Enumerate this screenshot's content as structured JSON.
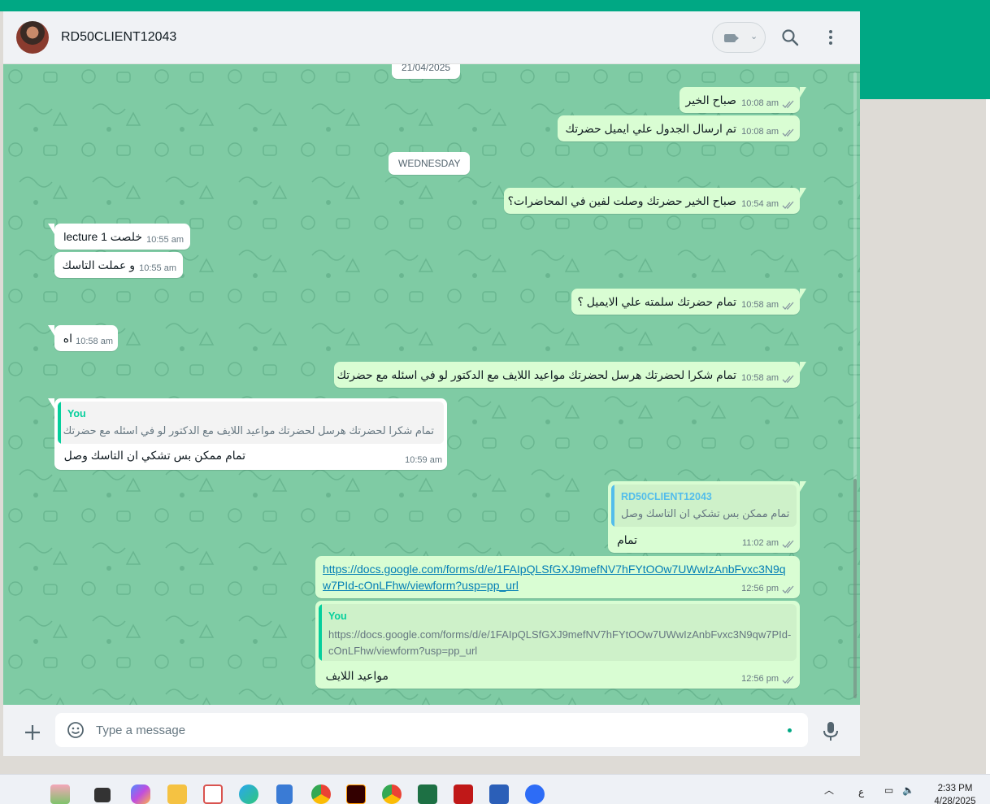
{
  "contact": {
    "name": "RD50CLIENT12043"
  },
  "date_chips": {
    "top": "21/04/2025",
    "wednesday": "WEDNESDAY"
  },
  "messages": [
    {
      "text": "صباح الخير",
      "time": "10:08 am"
    },
    {
      "text": "تم ارسال الجدول علي  ايميل  حضرتك",
      "time": "10:08 am"
    },
    {
      "text": "صباح الخير حضرتك وصلت لفين في المحاضرات؟",
      "time": "10:54 am"
    },
    {
      "text": "خلصت lecture 1",
      "time": "10:55 am"
    },
    {
      "text": "و عملت التاسك",
      "time": "10:55 am"
    },
    {
      "text": "تمام حضرتك سلمته علي الايميل ؟",
      "time": "10:58 am"
    },
    {
      "text": "اه",
      "time": "10:58 am"
    },
    {
      "text": "تمام شكرا لحضرتك هرسل لحضرتك مواعيد اللايف مع الدكتور لو في اسئله مع حضرتك",
      "time": "10:58 am"
    },
    {
      "quote_author": "You",
      "quote_text": "تمام شكرا لحضرتك هرسل لحضرتك مواعيد اللايف مع الدكتور لو في اسئله مع حضرتك",
      "text": "تمام ممكن بس تشكي ان التاسك وصل",
      "time": "10:59 am"
    },
    {
      "quote_author": "RD50CLIENT12043",
      "quote_text": "تمام ممكن بس تشكي ان التاسك وصل",
      "text": "تمام",
      "time": "11:02 am"
    },
    {
      "link": "https://docs.google.com/forms/d/e/1FAIpQLSfGXJ9mefNV7hFYtOOw7UWwIzAnbFvxc3N9qw7PId-cOnLFhw/viewform?usp=pp_url",
      "time": "12:56 pm"
    },
    {
      "quote_author": "You",
      "quote_text": "https://docs.google.com/forms/d/e/1FAIpQLSfGXJ9mefNV7hFYtOOw7UWwIzAnbFvxc3N9qw7PId-cOnLFhw/viewform?usp=pp_url",
      "text": "مواعيد اللايف",
      "time": "12:56 pm"
    }
  ],
  "composer": {
    "placeholder": "Type a message"
  },
  "taskbar": {
    "time": "2:33 PM",
    "date": "4/28/2025",
    "lang": "ع"
  },
  "colors": {
    "accent": "#00a884",
    "chat_bg": "#7fcba4",
    "outgoing": "#d9fdd3",
    "incoming": "#ffffff",
    "you_author": "#06cf9c",
    "contact_author": "#53bdeb"
  },
  "icons": [
    "video-call-icon",
    "chevron-down-icon",
    "search-icon",
    "menu-icon",
    "plus-icon",
    "emoji-icon",
    "mic-icon",
    "double-check-icon"
  ]
}
